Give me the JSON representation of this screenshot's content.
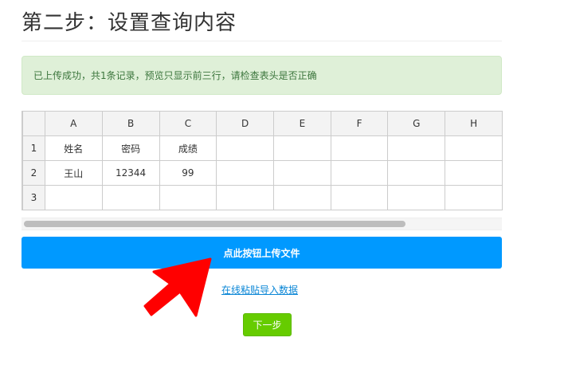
{
  "title": "第二步：设置查询内容",
  "alert": "已上传成功，共1条记录，预览只显示前三行，请检查表头是否正确",
  "grid": {
    "columns": [
      "A",
      "B",
      "C",
      "D",
      "E",
      "F",
      "G",
      "H"
    ],
    "rows": [
      {
        "num": "1",
        "cells": [
          "姓名",
          "密码",
          "成绩",
          "",
          "",
          "",
          "",
          ""
        ]
      },
      {
        "num": "2",
        "cells": [
          "王山",
          "12344",
          "99",
          "",
          "",
          "",
          "",
          ""
        ]
      },
      {
        "num": "3",
        "cells": [
          "",
          "",
          "",
          "",
          "",
          "",
          "",
          ""
        ]
      }
    ]
  },
  "upload_label": "点此按钮上传文件",
  "paste_link": "在线粘贴导入数据",
  "next_label": "下一步",
  "colors": {
    "upload": "#0099ff",
    "next": "#66cc00",
    "alert_bg": "#dff0d8",
    "arrow": "#ff0000"
  }
}
